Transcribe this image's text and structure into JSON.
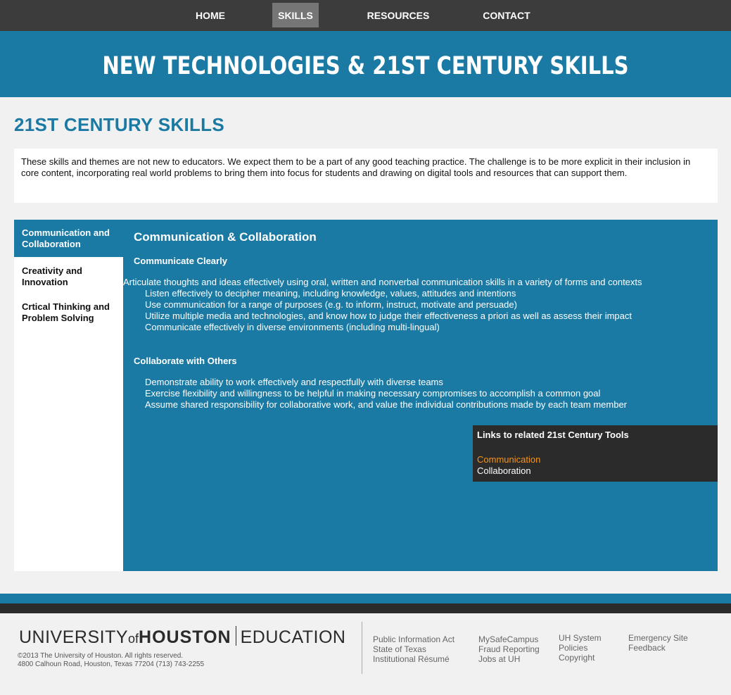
{
  "nav": {
    "items": [
      "HOME",
      "SKILLS",
      "RESOURCES",
      "CONTACT"
    ],
    "active": "SKILLS"
  },
  "banner": {
    "title": "NEW TECHNOLOGIES & 21ST CENTURY SKILLS"
  },
  "page": {
    "heading": "21ST CENTURY SKILLS",
    "intro": "These skills and themes are not new to educators. We expect them to be a part of any good teaching practice. The challenge is to be more explicit in their inclusion in core content, incorporating real world problems to bring them into focus for students and drawing on digital tools and resources that can support them."
  },
  "sidebar": {
    "items": [
      "Communication and Collaboration",
      "Creativity and Innovation",
      "Crtical Thinking and Problem Solving"
    ]
  },
  "content": {
    "title": "Communication & Collaboration",
    "section1": {
      "heading": "Communicate Clearly",
      "items": [
        "Articulate thoughts and ideas effectively using oral, written and nonverbal communication skills in a variety of forms and contexts",
        "Listen effectively to decipher meaning, including knowledge, values, attitudes and intentions",
        "Use communication for a range of purposes (e.g. to inform, instruct, motivate and persuade)",
        "Utilize multiple media and technologies, and know how to judge their effectiveness a priori as well as assess their impact",
        "Communicate effectively in diverse environments (including multi-lingual)"
      ]
    },
    "section2": {
      "heading": "Collaborate with Others",
      "items": [
        "Demonstrate ability to work effectively and respectfully with diverse teams",
        "Exercise flexibility and willingness to be helpful in making necessary compromises to accomplish a common goal",
        "Assume shared responsibility for collaborative work, and value the individual contributions made by each team member"
      ]
    },
    "links_box": {
      "title": "Links to related 21st Century Tools",
      "links": [
        "Communication",
        "Collaboration"
      ]
    }
  },
  "footer": {
    "logo": {
      "university": "UNIVERSITY",
      "of": "of",
      "houston": "HOUSTON",
      "education": "EDUCATION"
    },
    "copyright": "©2013 The University of Houston. All rights reserved.",
    "address": "4800 Calhoun Road, Houston, Texas 77204 (713) 743-2255",
    "col1": [
      "Public Information Act",
      "State of Texas",
      "Institutional Résumé"
    ],
    "col2": [
      "MySafeCampus",
      "Fraud Reporting",
      "Jobs at UH"
    ],
    "col3": [
      "UH System",
      "Policies",
      "Copyright"
    ],
    "col4": [
      "Emergency Site",
      "Feedback"
    ]
  },
  "colors": {
    "accent_blue": "#1a7aa4",
    "nav_dark": "#3c3c3c",
    "link_orange": "#f7941d",
    "box_dark": "#2b2b2b"
  }
}
